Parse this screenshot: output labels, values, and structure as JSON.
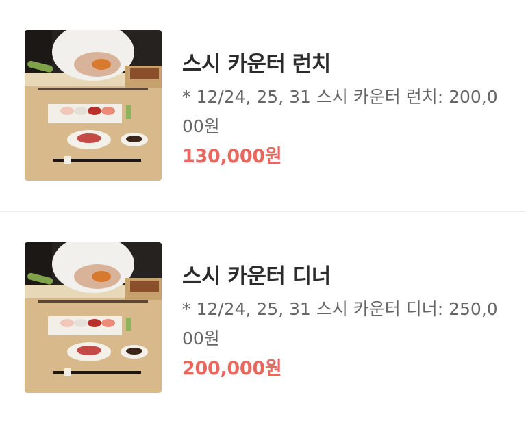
{
  "items": [
    {
      "image_name": "sushi-counter-photo",
      "title": "스시 카운터 런치",
      "description": "* 12/24, 25, 31 스시 카운터 런치: 200,000원",
      "price": "130,000원"
    },
    {
      "image_name": "sushi-counter-photo",
      "title": "스시 카운터 디너",
      "description": "* 12/24, 25, 31 스시 카운터 디너: 250,000원",
      "price": "200,000원"
    }
  ],
  "colors": {
    "title": "#2b2b2b",
    "description": "#666666",
    "price": "#e8675f",
    "divider": "#eeeeee"
  }
}
